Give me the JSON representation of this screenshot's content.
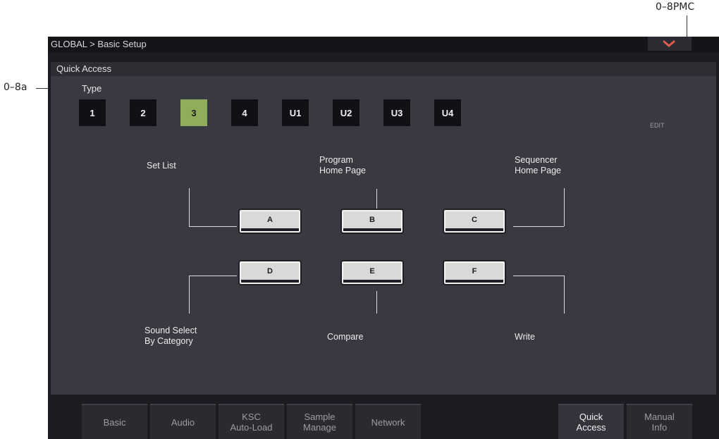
{
  "callouts": {
    "top_right": "0–8PMC",
    "left": "0–8a"
  },
  "screen": {
    "title": "GLOBAL > Basic Setup",
    "menu_icon": "chevron-down-icon",
    "panel_title": "Quick Access",
    "type_label": "Type",
    "type_buttons": [
      "1",
      "2",
      "3",
      "4",
      "U1",
      "U2",
      "U3",
      "U4"
    ],
    "selected_type": "3",
    "edit_label": "EDIT",
    "functions": {
      "a": {
        "key": "A",
        "line1": "Set List",
        "line2": ""
      },
      "b": {
        "key": "B",
        "line1": "Program",
        "line2": "Home Page"
      },
      "c": {
        "key": "C",
        "line1": "Sequencer",
        "line2": "Home Page"
      },
      "d": {
        "key": "D",
        "line1": "Sound Select",
        "line2": "By Category"
      },
      "e": {
        "key": "E",
        "line1": "Compare",
        "line2": ""
      },
      "f": {
        "key": "F",
        "line1": "Write",
        "line2": ""
      }
    },
    "tabs": [
      {
        "line1": "Basic",
        "line2": ""
      },
      {
        "line1": "Audio",
        "line2": ""
      },
      {
        "line1": "KSC",
        "line2": "Auto-Load"
      },
      {
        "line1": "Sample",
        "line2": "Manage"
      },
      {
        "line1": "Network",
        "line2": ""
      },
      {
        "line1": "Quick",
        "line2": "Access"
      },
      {
        "line1": "Manual",
        "line2": "Info"
      }
    ],
    "active_tab": "Quick Access",
    "colors": {
      "selected_button": "#8fad5a",
      "menu_chevron": "#e05a50",
      "panel_bg": "#393a41"
    }
  }
}
